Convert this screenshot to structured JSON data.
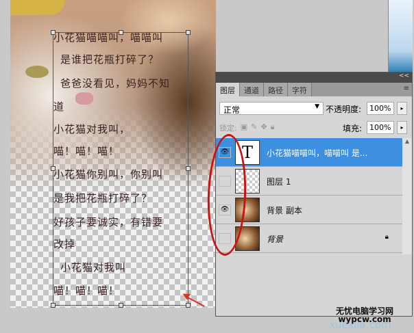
{
  "canvas": {
    "text_lines": [
      "小花猫喵喵叫，喵喵叫",
      "是谁把花瓶打碎了？",
      "爸爸没看见，妈妈不知",
      "道",
      "小花猫对我叫，",
      "喵！喵！喵！",
      "小花猫你别叫，你别叫",
      "是我把花瓶打碎了？",
      "好孩子要诚实，有错要",
      "改掉",
      "小花猫对我叫",
      "喵！喵！喵！"
    ]
  },
  "panel": {
    "collapse_label": "<<",
    "tabs": [
      {
        "label": "图层",
        "active": true
      },
      {
        "label": "通道"
      },
      {
        "label": "路径"
      },
      {
        "label": "字符"
      }
    ],
    "menu_icon": "≡",
    "blend_mode": "正常",
    "opacity_label": "不透明度:",
    "opacity_value": "100%",
    "lock_label": "锁定:",
    "fill_label": "填充:",
    "fill_value": "100%",
    "layers": [
      {
        "name": "小花猫喵喵叫，喵喵叫  是...",
        "thumb": "T",
        "visible": true,
        "selected": true
      },
      {
        "name": "图层 1",
        "visible": false
      },
      {
        "name": "背景 副本",
        "visible": true
      },
      {
        "name": "背景",
        "visible": false,
        "locked": true
      }
    ]
  },
  "watermark": {
    "line1": "无忧电脑学习网",
    "line2": "wypcw.com",
    "line3": "xuexila.com"
  },
  "colors": {
    "selected": "#3d8fe0",
    "annotation": "#cc1111"
  }
}
